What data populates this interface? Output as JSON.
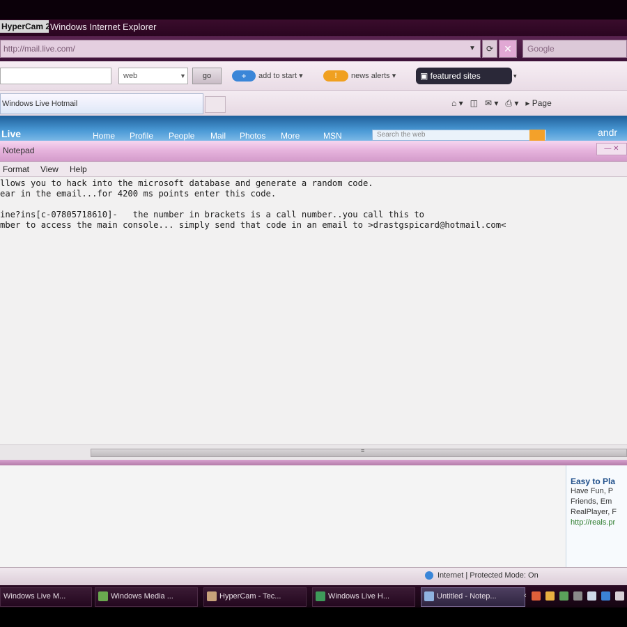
{
  "window": {
    "camcorder_logo": "HyperCam 2",
    "title": "Windows Internet Explorer"
  },
  "address_bar": {
    "url": "http://mail.live.com/",
    "search_placeholder": "Google"
  },
  "toolbar": {
    "search_value": "",
    "select_value": "web",
    "go_label": "go",
    "add_label": "add to start",
    "news_label": "news alerts",
    "featured_label": "featured sites"
  },
  "tabs": [
    {
      "label": "Windows Live Hotmail"
    }
  ],
  "command_bar": {
    "page_label": "Page"
  },
  "webpage_nav": {
    "logo": "Live",
    "items": [
      "Home",
      "Profile",
      "People",
      "Mail",
      "Photos",
      "More",
      "MSN"
    ],
    "search_placeholder": "Search the web",
    "right_text": "andr"
  },
  "notepad": {
    "title": "Notepad",
    "menu": [
      "Format",
      "View",
      "Help"
    ],
    "lines": [
      "llows you to hack into the microsoft database and generate a random code.",
      "ear in the email...for 4200 ms points enter this code.",
      "",
      "ine?ins[c-07805718610]-   the number in brackets is a call number..you call this to",
      "mber to access the main console... simply send that code in an email to >drastgspicard@hotmail.com<"
    ]
  },
  "sidebar_ad": {
    "title": "Easy to Pla",
    "lines": [
      "Have Fun, P",
      "Friends, Em",
      "RealPlayer, F"
    ],
    "link": "http://reals.pr"
  },
  "status_bar": {
    "zone_text": "Internet | Protected Mode: On"
  },
  "taskbar": {
    "buttons": [
      {
        "label": "Windows Live M..."
      },
      {
        "label": "Windows Media ..."
      },
      {
        "label": "HyperCam - Tec..."
      },
      {
        "label": "Windows Live H..."
      },
      {
        "label": "Untitled - Notep..."
      }
    ]
  },
  "colors": {
    "title_bg": "#2a0520",
    "accent_purple": "#d49ccb",
    "nav_blue": "#1e5f9a",
    "featured_bg": "#2a2838"
  }
}
